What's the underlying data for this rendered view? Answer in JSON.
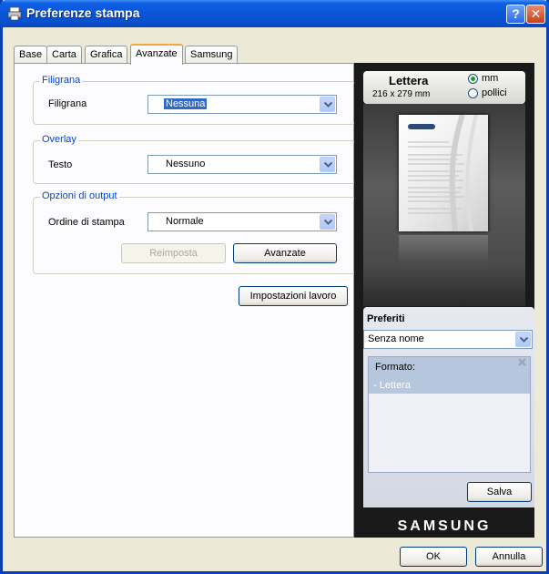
{
  "window": {
    "title": "Preferenze stampa",
    "help_label": "?",
    "close_label": "✕"
  },
  "tabs": [
    {
      "label": "Base"
    },
    {
      "label": "Carta"
    },
    {
      "label": "Grafica"
    },
    {
      "label": "Avanzate"
    },
    {
      "label": "Samsung"
    }
  ],
  "active_tab": "Avanzate",
  "watermark": {
    "group": "Filigrana",
    "label": "Filigrana",
    "value": "Nessuna"
  },
  "overlay": {
    "group": "Overlay",
    "label": "Testo",
    "value": "Nessuno"
  },
  "output": {
    "group": "Opzioni di output",
    "label": "Ordine di stampa",
    "value": "Normale",
    "reset_label": "Reimposta",
    "advanced_label": "Avanzate"
  },
  "job_settings_label": "Impostazioni lavoro",
  "preview": {
    "paper_name": "Lettera",
    "paper_dims": "216 x 279 mm",
    "unit_mm": "mm",
    "unit_inch": "pollici",
    "selected_unit": "mm"
  },
  "favorites": {
    "title": "Preferiti",
    "selected": "Senza nome",
    "item_title": "Formato:",
    "item_value": "- Lettera",
    "save_label": "Salva"
  },
  "brand": "SAMSUNG",
  "footer": {
    "ok_label": "OK",
    "cancel_label": "Annulla"
  },
  "colors": {
    "title_bar": "#0a55d6",
    "group_legend": "#0046d5",
    "tab_highlight": "#f2a83b"
  },
  "icons": [
    "printer-icon",
    "help-icon",
    "close-icon",
    "dropdown-arrow-icon",
    "remove-icon"
  ]
}
